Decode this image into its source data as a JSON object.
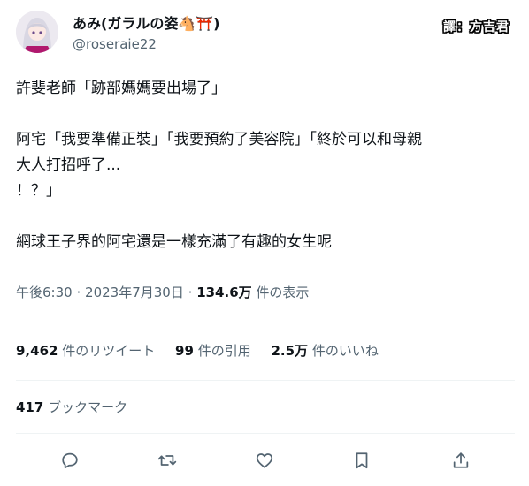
{
  "author": {
    "display_name": "あみ(ガラルの姿🐴⛩️)",
    "handle": "@roseraie22"
  },
  "translator_badge": "譯：方吉君",
  "tweet": {
    "lines": [
      "許斐老師「跡部媽媽要出場了」",
      "阿宅「我要準備正裝」「我要預約了美容院」「終於可以和母親",
      "大人打招呼了...",
      "！？」",
      "網球王子界的阿宅還是一樣充滿了有趣的女生呢"
    ]
  },
  "meta": {
    "time": "午後6:30",
    "separator": "·",
    "date": "2023年7月30日",
    "views_count": "134.6万",
    "views_label": "件の表示"
  },
  "stats": {
    "retweets_count": "9,462",
    "retweets_label": "件のリツイート",
    "quotes_count": "99",
    "quotes_label": "件の引用",
    "likes_count": "2.5万",
    "likes_label": "件のいいね"
  },
  "bookmarks": {
    "count": "417",
    "label": "ブックマーク"
  },
  "icons": {
    "reply": "reply-icon",
    "retweet": "retweet-icon",
    "like": "heart-icon",
    "bookmark": "bookmark-icon",
    "share": "share-icon"
  },
  "colors": {
    "text": "#0f1419",
    "secondary": "#536471",
    "divider": "#eff3f4",
    "avatar_hair": "#d9d7e3",
    "avatar_accent": "#b0186e"
  }
}
